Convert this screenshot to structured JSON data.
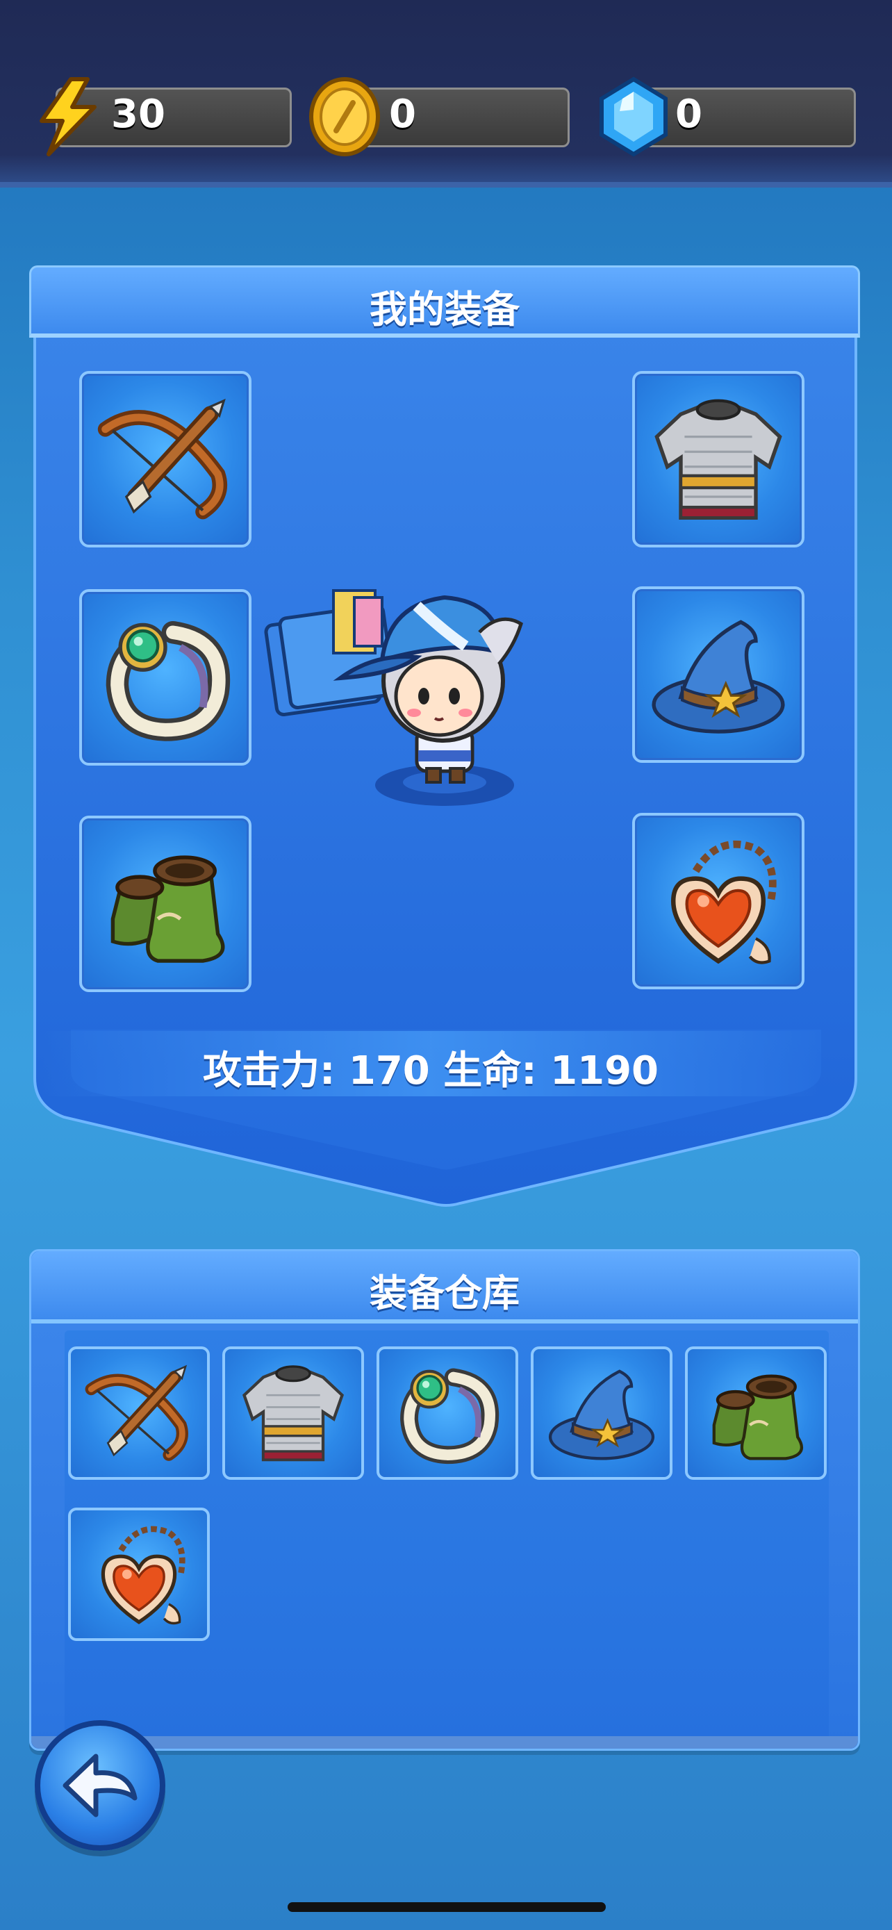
{
  "currency": {
    "energy": {
      "icon": "lightning-icon",
      "value": "30"
    },
    "coin": {
      "icon": "gold-coin-icon",
      "value": "0"
    },
    "gem": {
      "icon": "blue-gem-icon",
      "value": "0"
    }
  },
  "equipped": {
    "title": "我的装备",
    "slots": [
      {
        "icon": "crossbow-icon"
      },
      {
        "icon": "chainmail-armor-icon"
      },
      {
        "icon": "jade-ring-icon"
      },
      {
        "icon": "wizard-hat-icon"
      },
      {
        "icon": "leather-boots-icon"
      },
      {
        "icon": "heart-amulet-icon"
      }
    ],
    "stats_text": "攻击力: 170 生命: 1190"
  },
  "warehouse": {
    "title": "装备仓库",
    "items": [
      {
        "icon": "crossbow-icon"
      },
      {
        "icon": "chainmail-armor-icon"
      },
      {
        "icon": "jade-ring-icon"
      },
      {
        "icon": "wizard-hat-icon"
      },
      {
        "icon": "leather-boots-icon"
      },
      {
        "icon": "heart-amulet-icon"
      }
    ]
  },
  "colors": {
    "panel": "#2a74e0",
    "topbar": "#1f2a55",
    "accent": "#6fb6ff"
  },
  "back_button": {
    "icon": "back-arrow-icon"
  }
}
